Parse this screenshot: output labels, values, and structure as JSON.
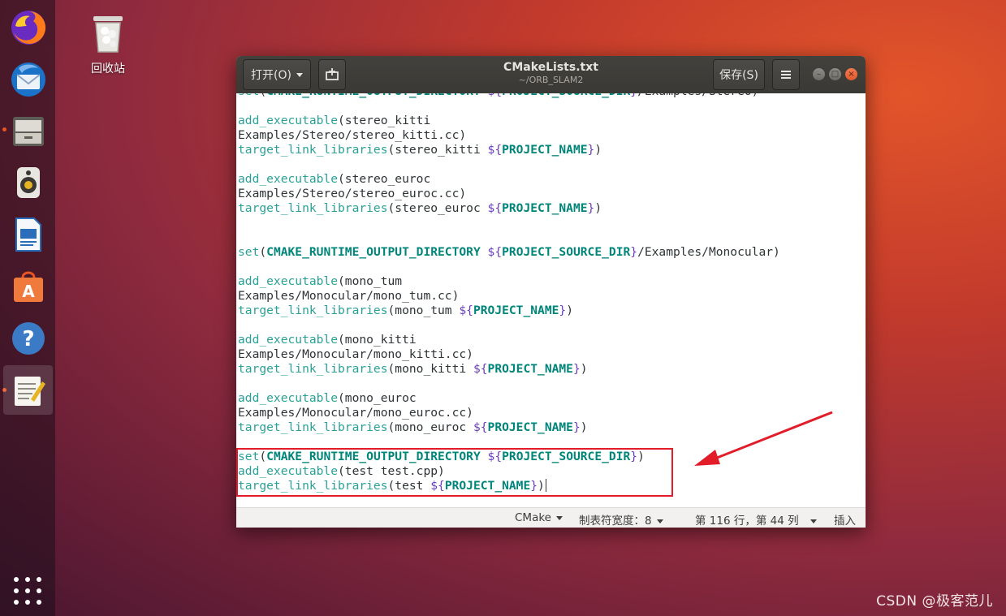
{
  "desktop": {
    "trash_label": "回收站",
    "watermark": "CSDN @极客范儿"
  },
  "dock": {
    "items": [
      {
        "name": "firefox"
      },
      {
        "name": "thunderbird"
      },
      {
        "name": "files"
      },
      {
        "name": "rhythmbox"
      },
      {
        "name": "libreoffice-writer"
      },
      {
        "name": "ubuntu-software"
      },
      {
        "name": "help"
      },
      {
        "name": "text-editor"
      }
    ],
    "apps_icon": "grid-icon"
  },
  "window": {
    "open_label": "打开(O)",
    "title": "CMakeLists.txt",
    "subtitle": "~/ORB_SLAM2",
    "save_label": "保存(S)",
    "menu_icon": "hamburger-icon"
  },
  "editor": {
    "lines": [
      "set(CMAKE_RUNTIME_OUTPUT_DIRECTORY ${PROJECT_SOURCE_DIR}/Examples/Stereo)",
      "",
      "add_executable(stereo_kitti",
      "Examples/Stereo/stereo_kitti.cc)",
      "target_link_libraries(stereo_kitti ${PROJECT_NAME})",
      "",
      "add_executable(stereo_euroc",
      "Examples/Stereo/stereo_euroc.cc)",
      "target_link_libraries(stereo_euroc ${PROJECT_NAME})",
      "",
      "",
      "set(CMAKE_RUNTIME_OUTPUT_DIRECTORY ${PROJECT_SOURCE_DIR}/Examples/Monocular)",
      "",
      "add_executable(mono_tum",
      "Examples/Monocular/mono_tum.cc)",
      "target_link_libraries(mono_tum ${PROJECT_NAME})",
      "",
      "add_executable(mono_kitti",
      "Examples/Monocular/mono_kitti.cc)",
      "target_link_libraries(mono_kitti ${PROJECT_NAME})",
      "",
      "add_executable(mono_euroc",
      "Examples/Monocular/mono_euroc.cc)",
      "target_link_libraries(mono_euroc ${PROJECT_NAME})",
      "",
      "set(CMAKE_RUNTIME_OUTPUT_DIRECTORY ${PROJECT_SOURCE_DIR})",
      "add_executable(test test.cpp)",
      "target_link_libraries(test ${PROJECT_NAME})"
    ]
  },
  "statusbar": {
    "language": "CMake",
    "tab_width": "制表符宽度：8",
    "position": "第 116 行，第 44 列",
    "mode": "插入"
  },
  "colors": {
    "accent": "#e95420",
    "highlight_box": "#e31c2a",
    "arrow": "#e31c2a",
    "function": "#2aa198",
    "keyword": "#00857a",
    "delimiter": "#6a3fc1"
  }
}
